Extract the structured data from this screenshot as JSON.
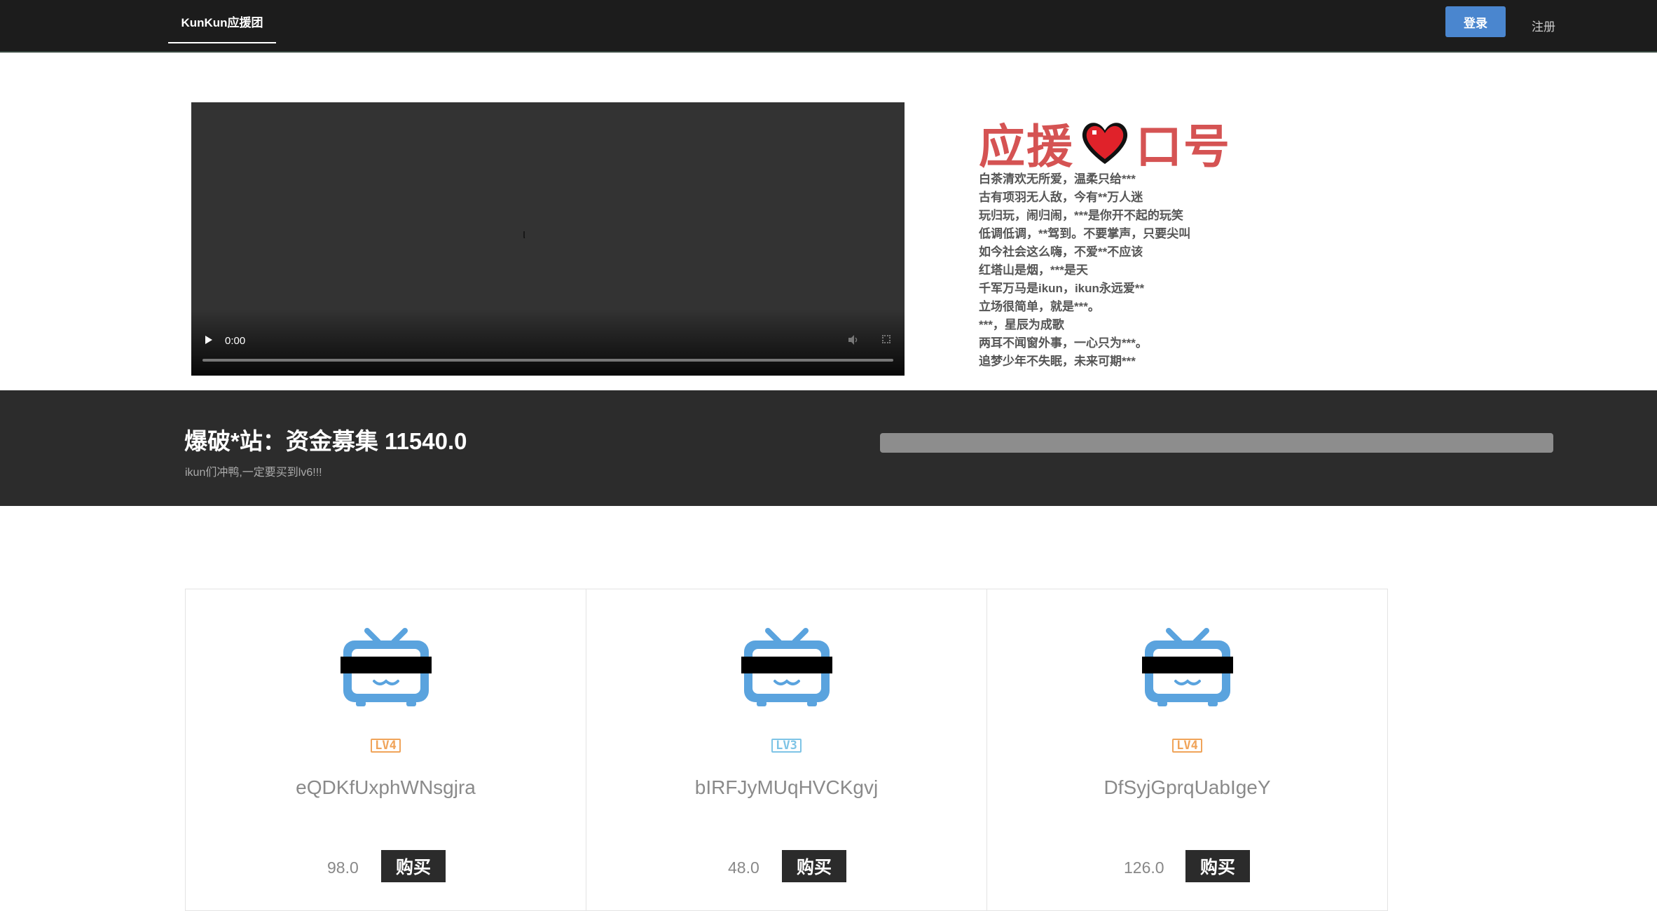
{
  "nav": {
    "brand": "KunKun应援团",
    "login_label": "登录",
    "register_label": "注册"
  },
  "video": {
    "time": "0:00"
  },
  "slogan": {
    "title_left": "应援",
    "title_right": "口号",
    "lines": [
      "白茶清欢无所爱，温柔只给***",
      "古有项羽无人敌，今有**万人迷",
      "玩归玩，闹归闹，***是你开不起的玩笑",
      "低调低调，**驾到。不要掌声，只要尖叫",
      "如今社会这么嗨，不爱**不应该",
      "红塔山是烟，***是天",
      "千军万马是ikun，ikun永远爱**",
      "立场很简单，就是***。",
      "***，星辰为成歌",
      "两耳不闻窗外事，一心只为***。",
      "追梦少年不失眠，未来可期***"
    ]
  },
  "fund": {
    "title": "爆破*站：资金募集 11540.0",
    "subtitle": "ikun们冲鸭,一定要买到lv6!!!"
  },
  "cards": [
    {
      "level": "LV4",
      "level_color": "#f0a45a",
      "name": "eQDKfUxphWNsgjra",
      "price": "98.0",
      "buy_label": "购买"
    },
    {
      "level": "LV3",
      "level_color": "#7ec4e6",
      "name": "bIRFJyMUqHVCKgvj",
      "price": "48.0",
      "buy_label": "购买"
    },
    {
      "level": "LV4",
      "level_color": "#f0a45a",
      "name": "DfSyjGprqUabIgeY",
      "price": "126.0",
      "buy_label": "购买"
    }
  ],
  "icons": {
    "tv": "bilibili-tv-icon",
    "heart": "heart-icon",
    "play": "play-icon",
    "volume": "volume-icon",
    "fullscreen": "fullscreen-icon"
  },
  "colors": {
    "nav_bg": "#1c1c1c",
    "login_button": "#4a86cf",
    "slogan_title": "#d55353",
    "fund_band": "#2c2c2c",
    "tv_blue": "#5aa3de"
  }
}
